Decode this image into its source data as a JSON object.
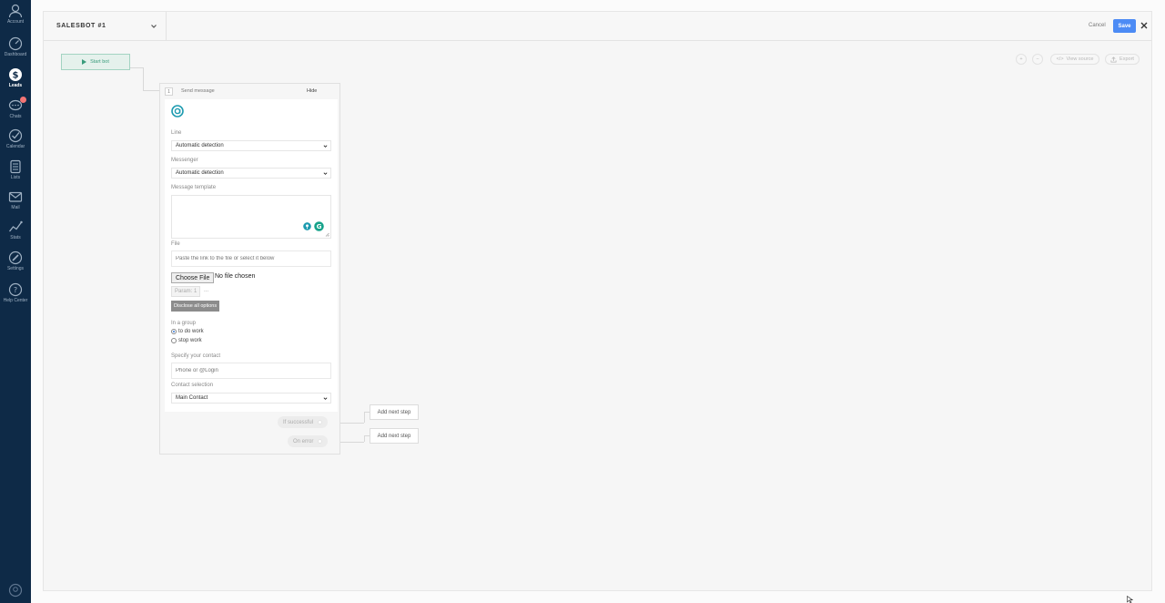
{
  "nav": {
    "items": [
      {
        "label": "Account",
        "icon": "user-icon"
      },
      {
        "label": "Dashboard",
        "icon": "speedometer-icon"
      },
      {
        "label": "Leads",
        "icon": "leads-icon"
      },
      {
        "label": "Chats",
        "icon": "chat-icon"
      },
      {
        "label": "Calendar",
        "icon": "check-circle-icon"
      },
      {
        "label": "Lists",
        "icon": "list-icon"
      },
      {
        "label": "Mail",
        "icon": "mail-icon"
      },
      {
        "label": "Stats",
        "icon": "stats-icon"
      },
      {
        "label": "Settings",
        "icon": "wrench-icon"
      },
      {
        "label": "Help Center",
        "icon": "help-icon"
      }
    ],
    "active": "Leads"
  },
  "header": {
    "title": "SALESBOT #1",
    "cancel_label": "Cancel",
    "save_label": "Save"
  },
  "toolbar": {
    "view_source_label": "View source",
    "export_label": "Export"
  },
  "start_bot_label": "Start bot",
  "step": {
    "number": "1",
    "name": "Send message",
    "hide_label": "Hide",
    "line_label": "Line",
    "line_value": "Automatic detection",
    "messenger_label": "Messenger",
    "messenger_value": "Automatic detection",
    "template_label": "Message template",
    "file_label": "File",
    "file_placeholder": "Paste the link to the file or select it below",
    "choose_file_label": "Choose File",
    "no_file_label": "No file chosen",
    "param_label": "Param: 1",
    "disclose_label": "Disclose all options",
    "group_label": "In a group",
    "group_options": [
      "to do work",
      "stop work"
    ],
    "group_selected": "to do work",
    "contact_label": "Specify your contact",
    "contact_placeholder": "Phone or @Login",
    "contact_selection_label": "Contact selection",
    "contact_selection_value": "Main Contact"
  },
  "outcomes": {
    "success_label": "If successful",
    "error_label": "On error",
    "add_next_label": "Add next step"
  },
  "colors": {
    "nav_bg": "#0e2a47",
    "save_bg": "#4c8bf5",
    "start_green": "#3a9c7c"
  }
}
